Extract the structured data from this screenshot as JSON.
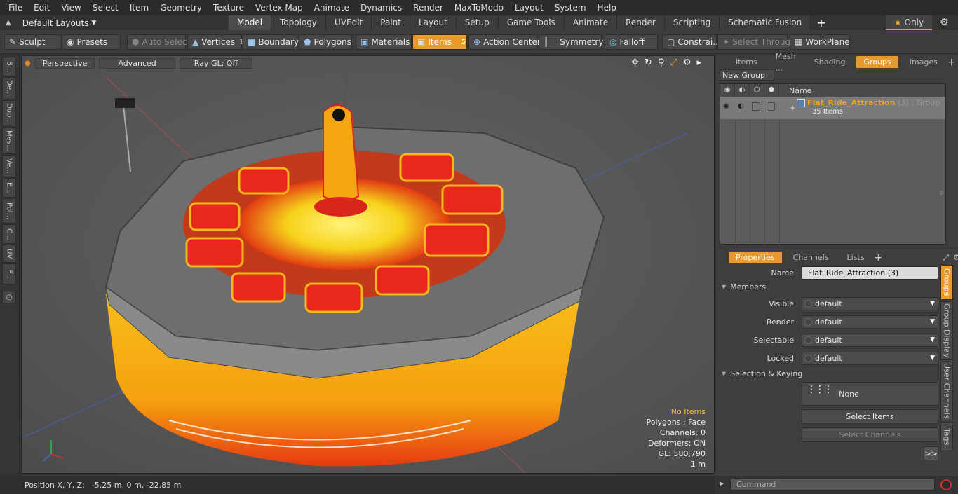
{
  "menu": [
    "File",
    "Edit",
    "View",
    "Select",
    "Item",
    "Geometry",
    "Texture",
    "Vertex Map",
    "Animate",
    "Dynamics",
    "Render",
    "MaxToModo",
    "Layout",
    "System",
    "Help"
  ],
  "layout_bar": {
    "layouts_label": "Default Layouts",
    "tabs": [
      "Model",
      "Topology",
      "UVEdit",
      "Paint",
      "Layout",
      "Setup",
      "Game Tools",
      "Animate",
      "Render",
      "Scripting",
      "Schematic Fusion"
    ],
    "active_tab": "Model",
    "only_label": "Only"
  },
  "toolbar": {
    "sculpt": "Sculpt",
    "presets": "Presets",
    "auto_select": "Auto Select",
    "vertices": "Vertices",
    "vertices_count": "1",
    "boundary": "Boundary",
    "polygons": "Polygons",
    "materials": "Materials",
    "items": "Items",
    "items_count": "5",
    "action_center": "Action Center",
    "symmetry": "Symmetry",
    "falloff": "Falloff",
    "constraints": "Constrai...",
    "select_through": "Select Through",
    "workplane": "WorkPlane"
  },
  "left_tabs": [
    "B...",
    "De...",
    "Dup...",
    "Mes...",
    "Ve...",
    "E...",
    "Pol...",
    "C...",
    "UV",
    "F..."
  ],
  "viewport": {
    "view_mode": "Perspective",
    "shading": "Advanced",
    "raygl": "Ray GL: Off",
    "stats": {
      "no_items": "No Items",
      "polygons": "Polygons : Face",
      "channels": "Channels: 0",
      "deformers": "Deformers: ON",
      "gl": "GL: 580,790",
      "scale": "1 m"
    }
  },
  "status": {
    "label": "Position X, Y, Z:",
    "value": "-5.25 m, 0 m, -22.85 m"
  },
  "groups_panel": {
    "tabs": [
      "Items",
      "Mesh ...",
      "Shading",
      "Groups",
      "Images"
    ],
    "active_tab": "Groups",
    "new_group": "New Group",
    "col_name": "Name",
    "group_name": "Flat_Ride_Attraction",
    "group_count": "(3)",
    "group_type": ": Group",
    "group_items": "35 Items"
  },
  "properties_panel": {
    "tabs": [
      "Properties",
      "Channels",
      "Lists"
    ],
    "active_tab": "Properties",
    "name_label": "Name",
    "name_value": "Flat_Ride_Attraction (3)",
    "members_section": "Members",
    "visible_label": "Visible",
    "visible_value": "default",
    "render_label": "Render",
    "render_value": "default",
    "selectable_label": "Selectable",
    "selectable_value": "default",
    "locked_label": "Locked",
    "locked_value": "default",
    "selection_section": "Selection & Keying",
    "none_label": "None",
    "select_items": "Select Items",
    "select_channels": "Select Channels",
    "more": ">>",
    "side_tabs": [
      "Groups",
      "Group Display",
      "User Channels",
      "Tags"
    ]
  },
  "command": {
    "placeholder": "Command"
  },
  "colors": {
    "accent": "#e79a2d",
    "group_name": "#f0a028",
    "stats_highlight": "#f2b54a"
  }
}
